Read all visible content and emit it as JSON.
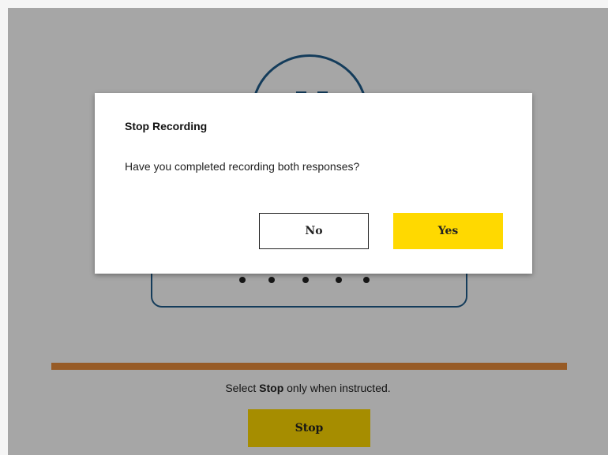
{
  "recorder": {
    "state_icon": "pause-icon",
    "accent_color": "#1f5c8c",
    "indicator_dots": 5
  },
  "progress": {
    "fraction": 1.0,
    "color": "#e98d3b"
  },
  "instruction": {
    "prefix": "Select",
    "emphasis": "Stop",
    "suffix": "only when instructed."
  },
  "stop_button": {
    "label": "Stop",
    "color": "#ffd900"
  },
  "dialog": {
    "title": "Stop Recording",
    "message": "Have you completed recording both responses?",
    "no_label": "No",
    "yes_label": "Yes",
    "yes_color": "#ffd900"
  }
}
